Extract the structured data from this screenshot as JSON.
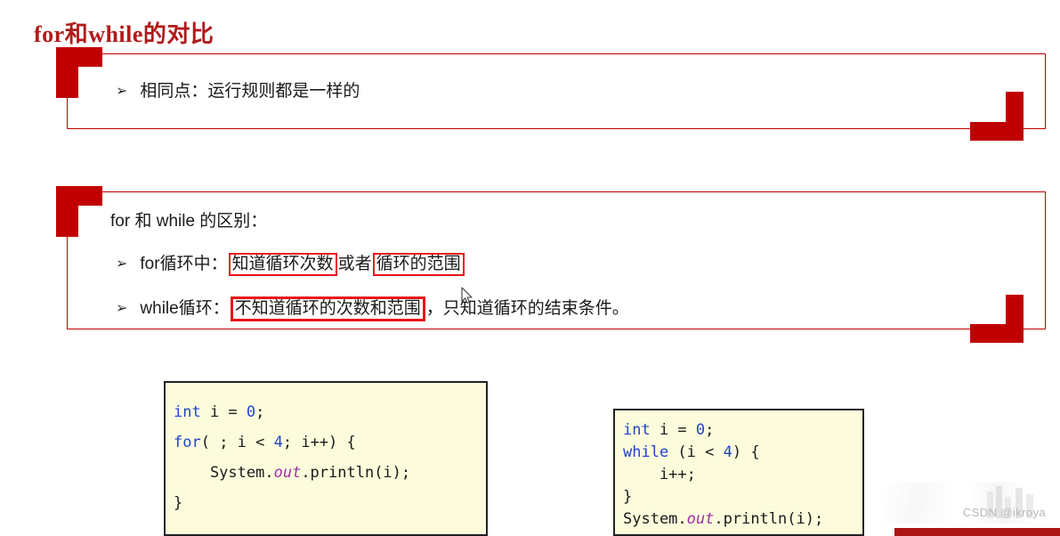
{
  "slide": {
    "title": "for和while的对比",
    "title_color": "#B01B1B",
    "accent_color": "#C00000",
    "highlight_color": "#E8131A"
  },
  "callout_1": {
    "bullet_glyph": "➢",
    "text": "相同点：运行规则都是一样的"
  },
  "callout_2": {
    "heading": "for 和 while 的区别：",
    "bullet_glyph": "➢",
    "row_for": {
      "label": "for循环中：",
      "highlight_1": "知道循环次数",
      "middle": "或者",
      "highlight_2": "循环的范围"
    },
    "row_while": {
      "label": "while循环：",
      "highlight_1": "不知道循环的次数和范围",
      "tail": "，只知道循环的结束条件。"
    }
  },
  "code_for": {
    "lines": [
      {
        "parts": [
          {
            "t": "int",
            "c": "kw"
          },
          {
            "t": " i = ",
            "c": ""
          },
          {
            "t": "0",
            "c": "num"
          },
          {
            "t": ";",
            "c": ""
          }
        ]
      },
      {
        "parts": [
          {
            "t": "for",
            "c": "kw"
          },
          {
            "t": "( ; i < ",
            "c": ""
          },
          {
            "t": "4",
            "c": "num"
          },
          {
            "t": "; i++) {",
            "c": ""
          }
        ]
      },
      {
        "parts": [
          {
            "t": "    System.",
            "c": ""
          },
          {
            "t": "out",
            "c": "fld"
          },
          {
            "t": ".println(i);",
            "c": ""
          }
        ]
      },
      {
        "parts": [
          {
            "t": "}",
            "c": ""
          }
        ]
      }
    ]
  },
  "code_while": {
    "lines": [
      {
        "parts": [
          {
            "t": "int",
            "c": "kw"
          },
          {
            "t": " i = ",
            "c": ""
          },
          {
            "t": "0",
            "c": "num"
          },
          {
            "t": ";",
            "c": ""
          }
        ]
      },
      {
        "parts": [
          {
            "t": "while",
            "c": "kw"
          },
          {
            "t": " (i < ",
            "c": ""
          },
          {
            "t": "4",
            "c": "num"
          },
          {
            "t": ") {",
            "c": ""
          }
        ]
      },
      {
        "parts": [
          {
            "t": "    i++;",
            "c": ""
          }
        ]
      },
      {
        "parts": [
          {
            "t": "}",
            "c": ""
          }
        ]
      },
      {
        "parts": [
          {
            "t": "System.",
            "c": ""
          },
          {
            "t": "out",
            "c": "fld"
          },
          {
            "t": ".println(i);",
            "c": ""
          }
        ]
      }
    ]
  },
  "watermark": {
    "text": "CSDN @ikroya"
  }
}
